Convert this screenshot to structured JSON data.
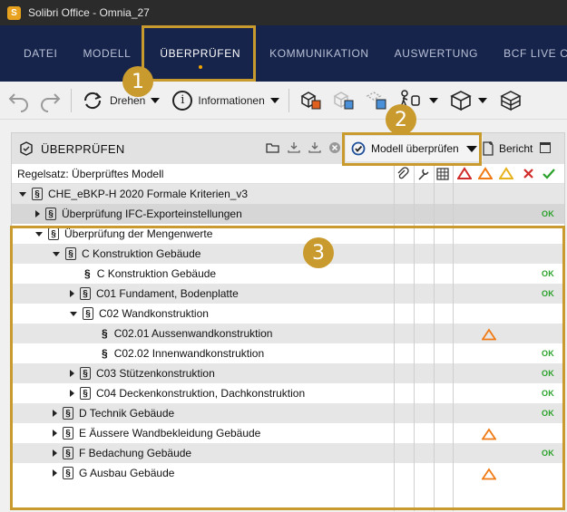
{
  "window": {
    "app_logo": "S",
    "title": "Solibri Office - Omnia_27"
  },
  "menu": {
    "items": [
      {
        "label": "DATEI",
        "active": false
      },
      {
        "label": "MODELL",
        "active": false
      },
      {
        "label": "ÜBERPRÜFEN",
        "active": true
      },
      {
        "label": "KOMMUNIKATION",
        "active": false
      },
      {
        "label": "AUSWERTUNG",
        "active": false
      },
      {
        "label": "BCF LIVE CO",
        "active": false
      }
    ]
  },
  "toolbar": {
    "rotate_label": "Drehen",
    "info_label": "Informationen",
    "info_glyph": "i"
  },
  "panel": {
    "title": "ÜBERPRÜFEN",
    "check_button": "Modell überprüfen",
    "report_button": "Bericht",
    "ruleset_label": "Regelsatz: Überprüftes Modell"
  },
  "tree": [
    {
      "label": "CHE_eBKP-H 2020 Formale Kriterien_v3",
      "status": ""
    },
    {
      "label": "Überprüfung IFC-Exporteinstellungen",
      "status": "OK"
    },
    {
      "label": "Überprüfung der Mengenwerte",
      "status": ""
    },
    {
      "label": "C Konstruktion Gebäude",
      "status": ""
    },
    {
      "label": "C Konstruktion Gebäude",
      "status": "OK"
    },
    {
      "label": "C01 Fundament, Bodenplatte",
      "status": "OK"
    },
    {
      "label": "C02 Wandkonstruktion",
      "status": ""
    },
    {
      "label": "C02.01 Aussenwandkonstruktion",
      "status": "warning"
    },
    {
      "label": "C02.02 Innenwandkonstruktion",
      "status": "OK"
    },
    {
      "label": "C03 Stützenkonstruktion",
      "status": "OK"
    },
    {
      "label": "C04 Deckenkonstruktion, Dachkonstruktion",
      "status": "OK"
    },
    {
      "label": "D Technik Gebäude",
      "status": "OK"
    },
    {
      "label": "E Äussere Wandbekleidung Gebäude",
      "status": "warning"
    },
    {
      "label": "F Bedachung Gebäude",
      "status": "OK"
    },
    {
      "label": "G Ausbau Gebäude",
      "status": "warning"
    }
  ],
  "badges": {
    "one": "1",
    "two": "2",
    "three": "3"
  },
  "colors": {
    "menubar": "#16234a",
    "highlight": "#c99a2e",
    "ok_green": "#2aa22a",
    "warning_orange": "#f07a14",
    "critical_red": "#d12a2a",
    "moderate_yellow": "#e8b21d"
  },
  "icons": {
    "undo": "undo-icon",
    "redo": "redo-icon",
    "rotate": "rotate-icon",
    "info": "info-icon",
    "check": "check-model-icon",
    "report": "report-icon"
  }
}
